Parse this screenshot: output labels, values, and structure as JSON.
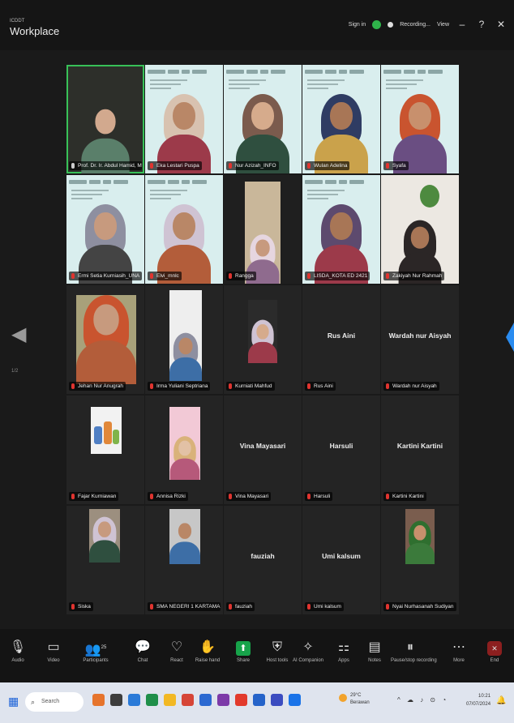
{
  "titlebar": {
    "app_small": "ICDDT",
    "app_name": "Workplace",
    "sign_label": "Sign in",
    "recording_label": "Recording...",
    "view_label": "View",
    "min": "–",
    "help": "?",
    "close": "✕"
  },
  "pager": {
    "left_arrow": "◀",
    "page": "1/2"
  },
  "tiles": [
    {
      "name": "Prof. Dr. Ir. Abdul Hamid, MBA",
      "kind": "video-man"
    },
    {
      "name": "Eka Lestari Puspa",
      "kind": "slide"
    },
    {
      "name": "Nur Azizah_INFO",
      "kind": "slide"
    },
    {
      "name": "Wulan Adelina",
      "kind": "slide"
    },
    {
      "name": "Syafa",
      "kind": "slide"
    },
    {
      "name": "Ermi Setia Kurniasih_UNA",
      "kind": "slide"
    },
    {
      "name": "Elvi_mnlc",
      "kind": "slide"
    },
    {
      "name": "Rangga",
      "kind": "video-dark"
    },
    {
      "name": "LISDA_KOTA ED 2421",
      "kind": "slide"
    },
    {
      "name": "Zakiyah Nur Rahmah",
      "kind": "video-plant"
    },
    {
      "name": "Jehan Nur Anugrah",
      "kind": "photo"
    },
    {
      "name": "Irma Yuliani Septriana",
      "kind": "photo"
    },
    {
      "name": "Kurniati Mahfud",
      "kind": "photo"
    },
    {
      "name": "Rus Aini",
      "kind": "name",
      "big": "Rus Aini"
    },
    {
      "name": "Wardah nur Aisyah",
      "kind": "name",
      "big": "Wardah nur Aisyah"
    },
    {
      "name": "Fajar Kurniawan",
      "kind": "avatar-cartoon"
    },
    {
      "name": "Annisa Rizki",
      "kind": "avatar-pink"
    },
    {
      "name": "Vina Mayasari",
      "kind": "name",
      "big": "Vina Mayasari"
    },
    {
      "name": "Harsuli",
      "kind": "name",
      "big": "Harsuli"
    },
    {
      "name": "Kartini Kartini",
      "kind": "name",
      "big": "Kartini Kartini"
    },
    {
      "name": "Siska",
      "kind": "photo"
    },
    {
      "name": "SMA NEGERI 1 KARTAMA",
      "kind": "photo-man"
    },
    {
      "name": "fauziah",
      "kind": "name",
      "big": "fauziah"
    },
    {
      "name": "Umi kalsum",
      "kind": "name",
      "big": "Umi kalsum"
    },
    {
      "name": "Nyai Nurhasanah Sudiyan",
      "kind": "photo-couple"
    }
  ],
  "toolbar": [
    {
      "label": "Audio",
      "icon": "🎙"
    },
    {
      "label": "Video",
      "icon": "▭"
    },
    {
      "label": "Participants",
      "icon": "👥",
      "badge": "25"
    },
    {
      "label": "Chat",
      "icon": "💬"
    },
    {
      "label": "React",
      "icon": "♡"
    },
    {
      "label": "Raise hand",
      "icon": "✋"
    },
    {
      "label": "Share",
      "icon": "⬆"
    },
    {
      "label": "Host tools",
      "icon": "⛨"
    },
    {
      "label": "AI Companion",
      "icon": "✧"
    },
    {
      "label": "Apps",
      "icon": "⚏"
    },
    {
      "label": "Notes",
      "icon": "▤"
    },
    {
      "label": "Pause/stop recording",
      "icon": "⏸"
    },
    {
      "label": "More",
      "icon": "⋯"
    },
    {
      "label": "End",
      "icon": "✕"
    }
  ],
  "taskbar": {
    "start": "▦",
    "search_placeholder": "Search",
    "weather_temp": "29°C",
    "weather_desc": "Berawan",
    "tray": "^ ☁ ♪ ⊙ ◔",
    "time": "10:21",
    "date": "07/07/2024",
    "notif": "🔔"
  },
  "colors": {
    "active_speaker": "#38c158",
    "share": "#17a34a",
    "end": "#8c1f1f",
    "accent": "#2a8cf0"
  }
}
